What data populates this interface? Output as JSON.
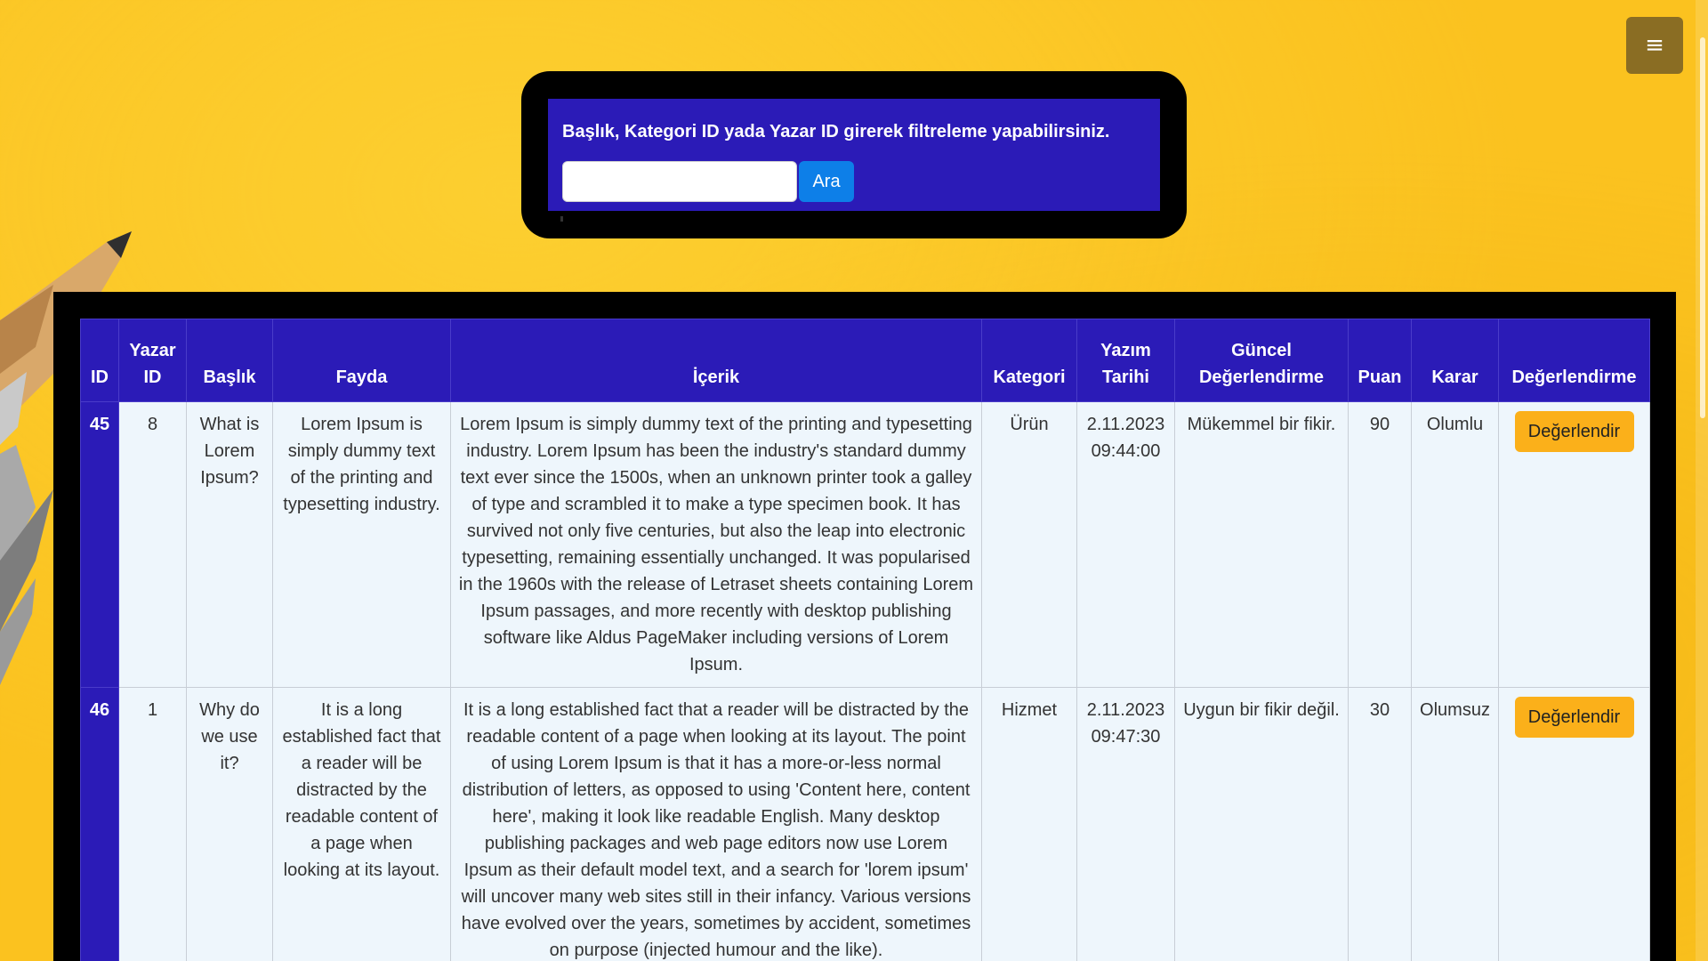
{
  "menu": {
    "icon": "hamburger-menu-icon",
    "label": "≡"
  },
  "search": {
    "hint": "Başlık, Kategori ID yada Yazar ID girerek filtreleme yapabilirsiniz.",
    "input_value": "",
    "placeholder": "",
    "button_label": "Ara"
  },
  "table": {
    "headers": {
      "id": "ID",
      "author_id": "Yazar ID",
      "title": "Başlık",
      "benefit": "Fayda",
      "content": "İçerik",
      "category": "Kategori",
      "written_date": "Yazım Tarihi",
      "current_review": "Güncel Değerlendirme",
      "score": "Puan",
      "decision": "Karar",
      "action": "Değerlendirme"
    },
    "rows": [
      {
        "id": "45",
        "author_id": "8",
        "title": "What is Lorem Ipsum?",
        "benefit": "Lorem Ipsum is simply dummy text of the printing and typesetting industry.",
        "content": "Lorem Ipsum is simply dummy text of the printing and typesetting industry. Lorem Ipsum has been the industry's standard dummy text ever since the 1500s, when an unknown printer took a galley of type and scrambled it to make a type specimen book. It has survived not only five centuries, but also the leap into electronic typesetting, remaining essentially unchanged. It was popularised in the 1960s with the release of Letraset sheets containing Lorem Ipsum passages, and more recently with desktop publishing software like Aldus PageMaker including versions of Lorem Ipsum.",
        "category": "Ürün",
        "date": "2.11.2023",
        "time": "09:44:00",
        "review": "Mükemmel bir fikir.",
        "score": "90",
        "decision": "Olumlu",
        "button_label": "Değerlendir"
      },
      {
        "id": "46",
        "author_id": "1",
        "title": "Why do we use it?",
        "benefit": "It is a long established fact that a reader will be distracted by the readable content of a page when looking at its layout.",
        "content": "It is a long established fact that a reader will be distracted by the readable content of a page when looking at its layout. The point of using Lorem Ipsum is that it has a more-or-less normal distribution of letters, as opposed to using 'Content here, content here', making it look like readable English. Many desktop publishing packages and web page editors now use Lorem Ipsum as their default model text, and a search for 'lorem ipsum' will uncover many web sites still in their infancy. Various versions have evolved over the years, sometimes by accident, sometimes on purpose (injected humour and the like).",
        "category": "Hizmet",
        "date": "2.11.2023",
        "time": "09:47:30",
        "review": "Uygun bir fikir değil.",
        "score": "30",
        "decision": "Olumsuz",
        "button_label": "Değerlendir"
      }
    ]
  },
  "colors": {
    "background": "#fbc21f",
    "panel_black": "#000000",
    "header_blue": "#2b1bb7",
    "search_button": "#0d7fe8",
    "eval_button": "#fbb01a",
    "cell_background": "#eef6fc",
    "menu_button": "#8a6d23"
  }
}
